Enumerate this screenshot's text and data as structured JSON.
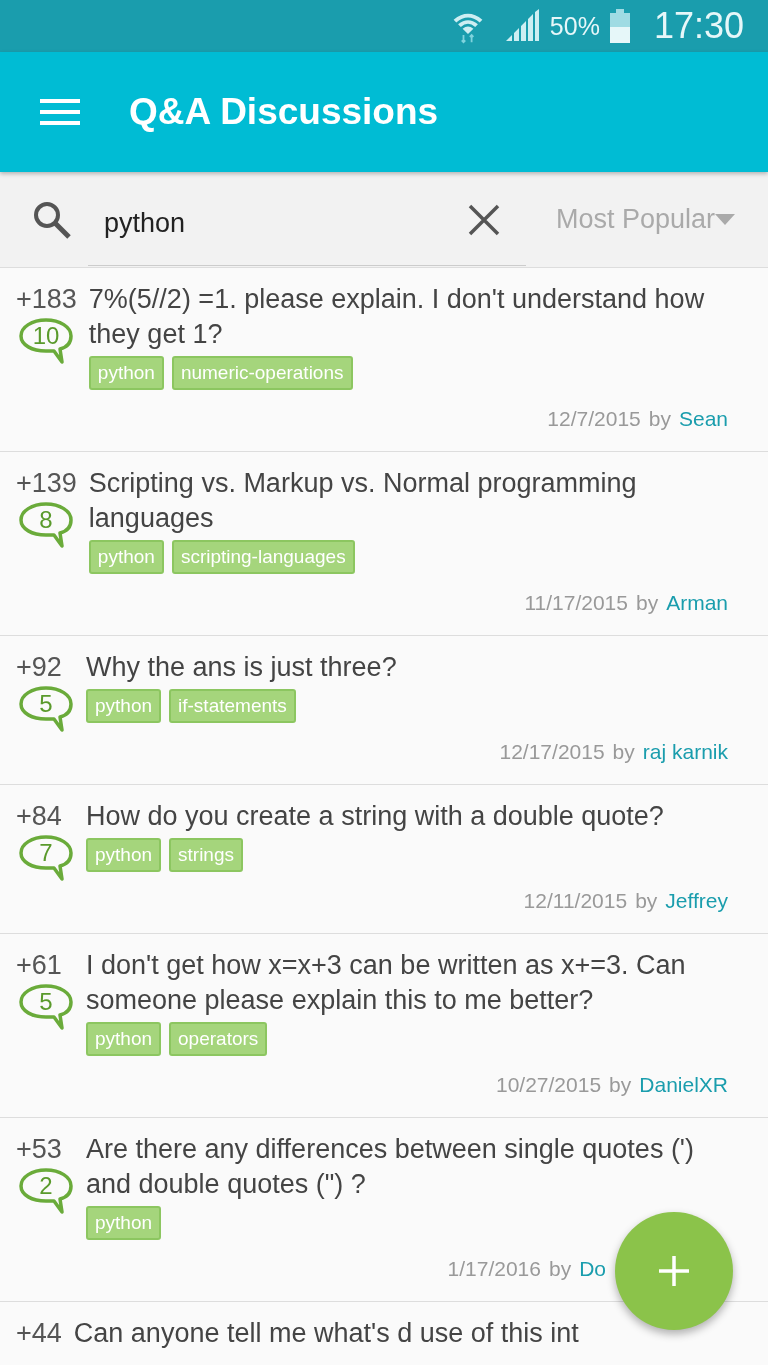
{
  "status_bar": {
    "battery": "50%",
    "time": "17:30"
  },
  "app_bar": {
    "title": "Q&A Discussions"
  },
  "search": {
    "value": "python"
  },
  "sort": {
    "label": "Most Popular"
  },
  "posts": [
    {
      "score": "+183",
      "answers": "10",
      "title": "7%(5//2) =1. please explain. I don't understand how they get 1?",
      "tags": [
        "python",
        "numeric-operations"
      ],
      "date": "12/7/2015",
      "by": "by",
      "author": "Sean"
    },
    {
      "score": "+139",
      "answers": "8",
      "title": "Scripting vs. Markup vs. Normal programming languages",
      "tags": [
        "python",
        "scripting-languages"
      ],
      "date": "11/17/2015",
      "by": "by",
      "author": "Arman"
    },
    {
      "score": "+92",
      "answers": "5",
      "title": "Why the ans is just three?",
      "tags": [
        "python",
        "if-statements"
      ],
      "date": "12/17/2015",
      "by": "by",
      "author": "raj karnik"
    },
    {
      "score": "+84",
      "answers": "7",
      "title": "How do you create a string with a double quote?",
      "tags": [
        "python",
        "strings"
      ],
      "date": "12/11/2015",
      "by": "by",
      "author": "Jeffrey"
    },
    {
      "score": "+61",
      "answers": "5",
      "title": "I don't get how x=x+3 can be written as x+=3. Can someone please explain this to me better?",
      "tags": [
        "python",
        "operators"
      ],
      "date": "10/27/2015",
      "by": "by",
      "author": "DanielXR"
    },
    {
      "score": "+53",
      "answers": "2",
      "title": "Are there any differences between single quotes (') and double quotes (\") ?",
      "tags": [
        "python"
      ],
      "date": "1/17/2016",
      "by": "by",
      "author": "Do"
    },
    {
      "score": "+44",
      "title": "Can anyone tell me what's d use of this int"
    }
  ]
}
